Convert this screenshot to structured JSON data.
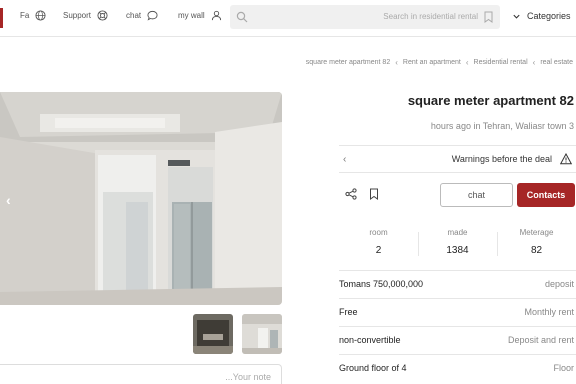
{
  "header": {
    "nav": {
      "fa_label": "Fa",
      "support_label": "Support",
      "chat_label": "chat",
      "my_wall_label": "my wall"
    },
    "search": {
      "placeholder": "Search in residential rental"
    },
    "categories_label": "Categories"
  },
  "breadcrumb": [
    "square meter apartment 82",
    "Rent an apartment",
    "Residential rental",
    "real estate"
  ],
  "listing": {
    "title": "square meter apartment 82",
    "subtitle": "hours ago in Tehran, Waliasr town 3",
    "warnings_label": "Warnings before the deal",
    "chat_button": "chat",
    "contacts_button": "Contacts",
    "stats": [
      {
        "label": "room",
        "value": "2"
      },
      {
        "label": "made",
        "value": "1384"
      },
      {
        "label": "Meterage",
        "value": "82"
      }
    ],
    "details": [
      {
        "left": "Tomans 750,000,000",
        "right": "deposit"
      },
      {
        "left": "Free",
        "right": "Monthly rent"
      },
      {
        "left": "non-convertible",
        "right": "Deposit and rent"
      },
      {
        "left": "Ground floor of 4",
        "right": "Floor"
      }
    ]
  },
  "note": {
    "placeholder": "...Your note"
  },
  "colors": {
    "accent": "#a62626",
    "border": "#e6e6e6",
    "muted": "#888888"
  },
  "icons": [
    "globe-icon",
    "lifebuoy-icon",
    "chat-bubble-icon",
    "user-icon",
    "search-icon",
    "bookmark-icon",
    "chevron-down-icon",
    "chevron-left-icon",
    "warning-icon",
    "share-icon"
  ]
}
